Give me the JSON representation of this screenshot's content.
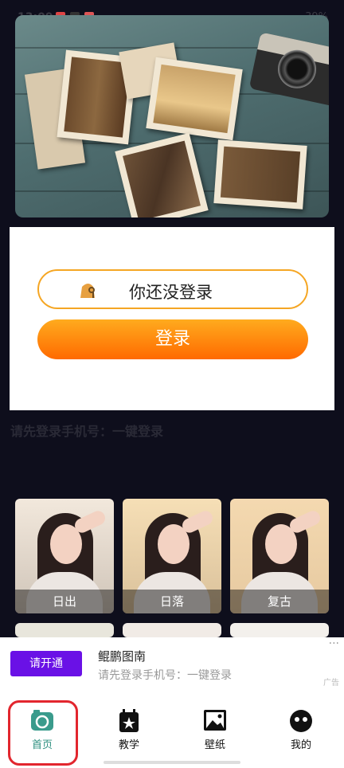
{
  "status_bar": {
    "time": "13:09",
    "battery": "39%"
  },
  "login_card": {
    "not_logged_text": "你还没登录",
    "login_button": "登录"
  },
  "hint": {
    "login_hint": "请先登录手机号：一键登录"
  },
  "filters": [
    {
      "label": "日出"
    },
    {
      "label": "日落"
    },
    {
      "label": "复古"
    }
  ],
  "ad": {
    "open_button": "请开通",
    "title": "鲲鹏图南",
    "subtitle": "请先登录手机号：一键登录",
    "tag": "广告",
    "more": "···"
  },
  "bottom_nav": [
    {
      "label": "首页",
      "icon": "camera-icon",
      "active": true
    },
    {
      "label": "教学",
      "icon": "calendar-star-icon",
      "active": false
    },
    {
      "label": "壁纸",
      "icon": "image-icon",
      "active": false
    },
    {
      "label": "我的",
      "icon": "face-icon",
      "active": false
    }
  ],
  "colors": {
    "accent": "#ff8a00",
    "active_nav": "#2d8f7f",
    "ad_button": "#6a11e6",
    "highlight": "#e2262e"
  }
}
